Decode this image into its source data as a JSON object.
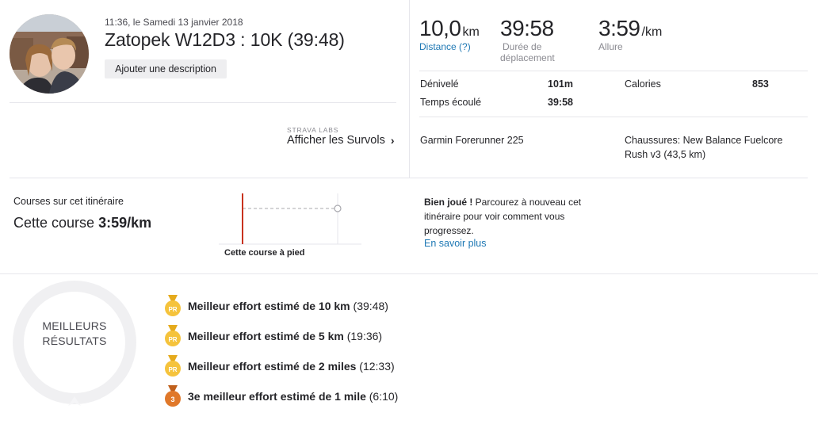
{
  "activity": {
    "datetime": "11:36, le Samedi 13 janvier 2018",
    "title": "Zatopek W12D3 : 10K (39:48)",
    "add_description": "Ajouter une description",
    "labs_label": "STRAVA LABS",
    "flyby_label": "Afficher les Survols"
  },
  "stats": {
    "distance": {
      "value": "10,0",
      "unit": "km",
      "label": "Distance (?)"
    },
    "moving_time": {
      "value": "39:58",
      "label_line1": "Durée de",
      "label_line2": "déplacement"
    },
    "pace": {
      "value": "3:59",
      "unit": "/km",
      "label": "Allure"
    },
    "elevation_label": "Dénivelé",
    "elevation_value": "101m",
    "calories_label": "Calories",
    "calories_value": "853",
    "elapsed_label": "Temps écoulé",
    "elapsed_value": "39:58",
    "device": "Garmin Forerunner 225",
    "shoes_line1": "Chaussures: New Balance Fuelcore",
    "shoes_line2": "Rush v3 (43,5 km)"
  },
  "route": {
    "title": "Courses sur cet itinéraire",
    "pace_prefix": "Cette course",
    "pace_value": "3:59/km",
    "graph_label": "Cette course à pied",
    "tip_bold": "Bien joué !",
    "tip_text": " Parcourez à nouveau cet itinéraire pour voir comment vous progressez.",
    "learn_more": "En savoir plus"
  },
  "achievements": {
    "heading_line1": "MEILLEURS",
    "heading_line2": "RÉSULTATS",
    "items": [
      {
        "medal": "PR",
        "label": "Meilleur effort estimé de 10 km",
        "time": "(39:48)",
        "color": "#f5c33c"
      },
      {
        "medal": "PR",
        "label": "Meilleur effort estimé de 5 km",
        "time": "(19:36)",
        "color": "#f5c33c"
      },
      {
        "medal": "PR",
        "label": "Meilleur effort estimé de 2 miles",
        "time": "(12:33)",
        "color": "#f5c33c"
      },
      {
        "medal": "3",
        "label": "3e meilleur effort estimé de 1 mile",
        "time": "(6:10)",
        "color": "#e0782a"
      }
    ]
  },
  "colors": {
    "link": "#1e78b4",
    "accent_line": "#c8321e",
    "border": "#e6e6eb"
  }
}
